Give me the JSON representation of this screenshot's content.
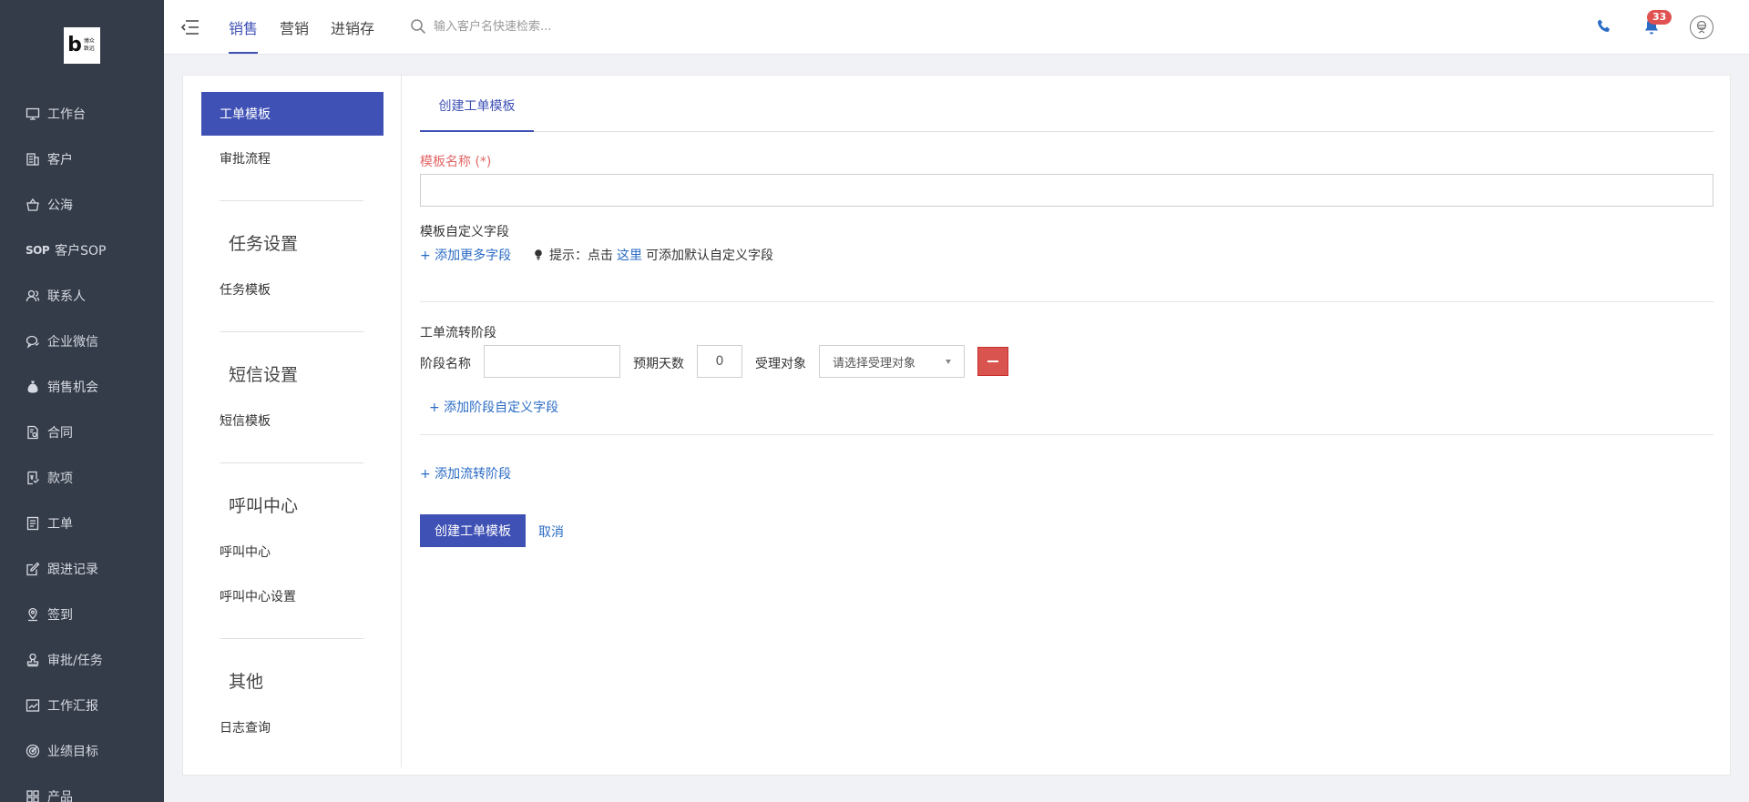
{
  "logo": {
    "letter": "b",
    "text": "博众致远"
  },
  "sidebar": {
    "items": [
      {
        "label": "工作台",
        "icon": "monitor-icon"
      },
      {
        "label": "客户",
        "icon": "building-icon"
      },
      {
        "label": "公海",
        "icon": "basket-icon"
      },
      {
        "label": "客户SOP",
        "icon": "sop-icon"
      },
      {
        "label": "联系人",
        "icon": "contacts-icon"
      },
      {
        "label": "企业微信",
        "icon": "wechat-icon"
      },
      {
        "label": "销售机会",
        "icon": "money-bag-icon"
      },
      {
        "label": "合同",
        "icon": "contract-icon"
      },
      {
        "label": "款项",
        "icon": "payment-icon"
      },
      {
        "label": "工单",
        "icon": "ticket-icon"
      },
      {
        "label": "跟进记录",
        "icon": "edit-icon"
      },
      {
        "label": "签到",
        "icon": "location-icon"
      },
      {
        "label": "审批/任务",
        "icon": "stamp-icon"
      },
      {
        "label": "工作汇报",
        "icon": "report-icon"
      },
      {
        "label": "业绩目标",
        "icon": "target-icon"
      },
      {
        "label": "产品",
        "icon": "grid-icon"
      }
    ]
  },
  "topbar": {
    "tabs": [
      "销售",
      "营销",
      "进销存"
    ],
    "active_tab": "销售",
    "search_placeholder": "输入客户名快速检索...",
    "notification_count": "33"
  },
  "settings_nav": {
    "group1": {
      "items": [
        "工单模板",
        "审批流程"
      ],
      "active": "工单模板"
    },
    "group2": {
      "title": "任务设置",
      "items": [
        "任务模板"
      ]
    },
    "group3": {
      "title": "短信设置",
      "items": [
        "短信模板"
      ]
    },
    "group4": {
      "title": "呼叫中心",
      "items": [
        "呼叫中心",
        "呼叫中心设置"
      ]
    },
    "group5": {
      "title": "其他",
      "items": [
        "日志查询"
      ]
    }
  },
  "form": {
    "tab": "创建工单模板",
    "name_label": "模板名称 (*)",
    "name_value": "",
    "custom_fields_label": "模板自定义字段",
    "add_more_fields": "+ 添加更多字段",
    "tip_prefix": "提示：点击",
    "tip_link": "这里",
    "tip_suffix": "可添加默认自定义字段",
    "stage_section_label": "工单流转阶段",
    "stage": {
      "name_label": "阶段名称",
      "name_value": "",
      "days_label": "预期天数",
      "days_value": "0",
      "assignee_label": "受理对象",
      "assignee_placeholder": "请选择受理对象"
    },
    "add_stage_field": "+ 添加阶段自定义字段",
    "add_stage": "+ 添加流转阶段",
    "submit": "创建工单模板",
    "cancel": "取消"
  }
}
